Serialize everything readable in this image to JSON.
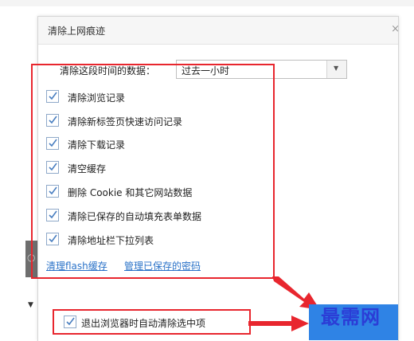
{
  "dialog": {
    "title": "清除上网痕迹",
    "close": "×"
  },
  "period": {
    "label": "清除这段时间的数据：",
    "selected": "过去一小时"
  },
  "options": [
    {
      "label": "清除浏览记录",
      "checked": true
    },
    {
      "label": "清除新标签页快速访问记录",
      "checked": true
    },
    {
      "label": "清除下载记录",
      "checked": true
    },
    {
      "label": "清空缓存",
      "checked": true
    },
    {
      "label": "删除 Cookie 和其它网站数据",
      "checked": true
    },
    {
      "label": "清除已保存的自动填充表单数据",
      "checked": true
    },
    {
      "label": "清除地址栏下拉列表",
      "checked": true
    }
  ],
  "links": {
    "flash": "清理flash缓存",
    "passwords": "管理已保存的密码"
  },
  "exit_option": {
    "label": "退出浏览器时自动清除选中项",
    "checked": true
  },
  "watermark": "最需网",
  "colors": {
    "highlight": "#e8262e",
    "link": "#2a72c8",
    "button": "#2f83e5",
    "checkmark": "#4a7fc1"
  }
}
